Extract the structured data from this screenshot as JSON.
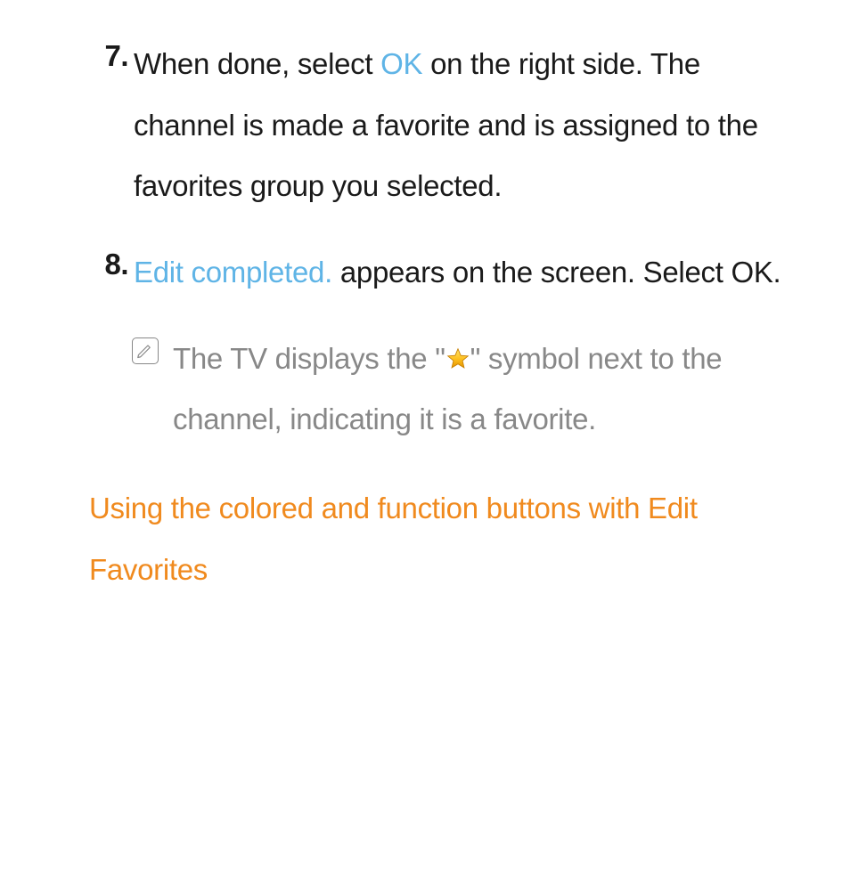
{
  "steps": {
    "7": {
      "num": "7.",
      "pre": "When done, select ",
      "hl": "OK",
      "post": " on the right side. The channel is made a favorite and is assigned to the favorites group you selected."
    },
    "8": {
      "num": "8.",
      "hl": "Edit completed.",
      "post": " appears on the screen. Select OK."
    }
  },
  "note": {
    "pre": "The TV displays the \"",
    "post": "\" symbol next to the channel, indicating it is a favorite."
  },
  "section_heading": "Using the colored and function buttons with Edit Favorites"
}
